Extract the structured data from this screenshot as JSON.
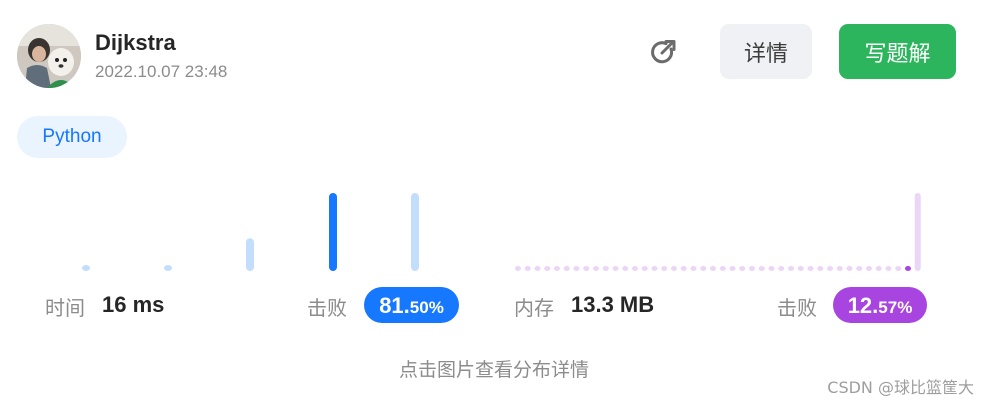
{
  "header": {
    "author_name": "Dijkstra",
    "timestamp": "2022.10.07 23:48",
    "detail_label": "详情",
    "write_solution_label": "写题解"
  },
  "language_tag": "Python",
  "runtime": {
    "label": "时间",
    "value": "16 ms",
    "beat_label": "击败",
    "beat_percent_int": "81.",
    "beat_percent_frac": "50%"
  },
  "memory": {
    "label": "内存",
    "value": "13.3 MB",
    "beat_label": "击败",
    "beat_percent_int": "12.",
    "beat_percent_frac": "57%"
  },
  "hint": "点击图片查看分布详情",
  "watermark": "CSDN @球比篮筐大",
  "colors": {
    "accent_green": "#2db55d",
    "runtime_blue": "#1677ff",
    "runtime_light": "#c3defc",
    "memory_purple": "#a844e0",
    "memory_light": "#ecd6f7"
  },
  "chart_data": [
    {
      "type": "bar",
      "series": [
        {
          "values": [
            0.05,
            0.05,
            0.42,
            1.0,
            1.0
          ]
        }
      ],
      "highlight_index": 3
    },
    {
      "type": "bar",
      "series": [
        {
          "values": [
            0.04,
            0.04,
            0.04,
            0.04,
            0.04,
            0.04,
            0.04,
            0.04,
            0.04,
            0.04,
            0.04,
            0.04,
            0.04,
            0.04,
            0.04,
            0.04,
            0.04,
            0.04,
            0.04,
            0.04,
            0.04,
            0.04,
            0.04,
            0.04,
            0.04,
            0.04,
            0.04,
            0.04,
            0.04,
            0.04,
            0.04,
            0.04,
            0.04,
            0.04,
            0.04,
            0.04,
            0.04,
            0.04,
            0.04,
            0.04,
            0.06,
            1.0
          ]
        }
      ],
      "highlight_index": 40
    }
  ]
}
